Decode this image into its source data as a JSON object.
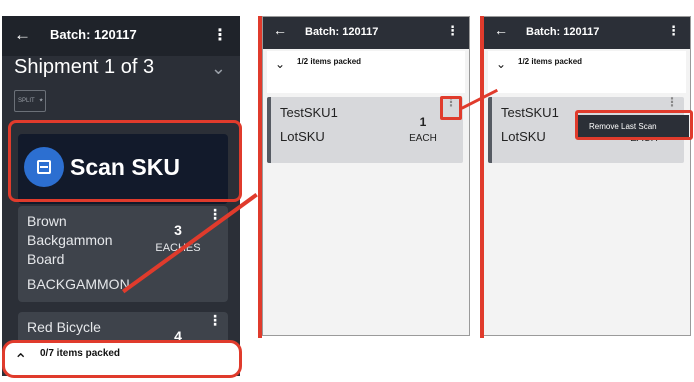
{
  "panel1": {
    "batch_title": "Batch: 120117",
    "shipment_title": "Shipment 1 of 3",
    "split_label": "SPLIT",
    "scan_button_label": "Scan SKU",
    "items": [
      {
        "name": "Brown Backgammon Board",
        "sku": "BACKGAMMON",
        "qty": "3",
        "unit": "EACHES"
      },
      {
        "name": "Red Bicycle",
        "sku": "",
        "qty": "4",
        "unit": ""
      }
    ],
    "footer_text": "0/7 items packed"
  },
  "panel2": {
    "batch_title": "Batch: 120117",
    "packed_text": "1/2 items packed",
    "item": {
      "sku": "TestSKU1",
      "lot": "LotSKU",
      "qty": "1",
      "unit": "EACH"
    }
  },
  "panel3": {
    "batch_title": "Batch: 120117",
    "packed_text": "1/2 items packed",
    "item": {
      "sku": "TestSKU1",
      "lot": "LotSKU",
      "unit": "EACH"
    },
    "menu_item": "Remove Last Scan"
  },
  "icons": {
    "back": "arrow-left-icon",
    "more": "kebab-icon",
    "expand": "chevron-down-icon",
    "collapse": "chevron-up-icon",
    "scan": "barcode-scan-icon",
    "split": "split-icon"
  },
  "colors": {
    "annotation_red": "#e03b2c",
    "scan_blue": "#2c6fd1",
    "dark_bg": "#2b2f37"
  }
}
